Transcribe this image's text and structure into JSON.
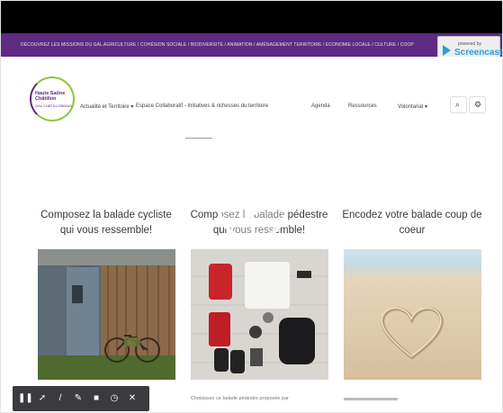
{
  "missions_bar": {
    "text": "DÉCOUVREZ LES MISSIONS DU GAL  AGRICULTURE / COHÉSION SOCIALE / BIODIVERSITÉ / ANIMATION / AMÉNAGEMENT TERRITOIRE / ECONOMIE LOCALE / CULTURE / COOP"
  },
  "screencast_badge": {
    "powered_label": "powered by",
    "name": "Screencast-O"
  },
  "logo": {
    "title": "Haute Saône Châtillon",
    "subtitle": "GAL CHÂTILLONNAIS"
  },
  "nav": {
    "items": [
      {
        "label": "Actualité et Territoire ▾"
      },
      {
        "label": "Espace Collaboratif - Initiatives & richesses du territoire"
      },
      {
        "label": "Agenda"
      },
      {
        "label": "Ressources"
      },
      {
        "label": "Volontariat ▾"
      }
    ],
    "search_icon": "magnifier",
    "settings_icon": "gear"
  },
  "cards": [
    {
      "title": "Composez la balade cycliste qui vous ressemble!"
    },
    {
      "title": "Composez la balade pédestre qui vous ressemble!"
    },
    {
      "title": "Encodez votre balade coup de coeur"
    }
  ],
  "below_card2": "Choisissez ce balade pédestre proposée par",
  "toolbar": {
    "icons": [
      "pause-icon",
      "pointer-icon",
      "pen-icon",
      "highlighter-icon",
      "camera-icon",
      "timer-icon",
      "close-icon"
    ],
    "glyphs": [
      "❚❚",
      "➚",
      "/",
      "✎",
      "■",
      "◷",
      "✕"
    ]
  },
  "colors": {
    "purple": "#5e2a82",
    "green": "#8cc63f",
    "screencast_blue": "#2a9fd6"
  }
}
